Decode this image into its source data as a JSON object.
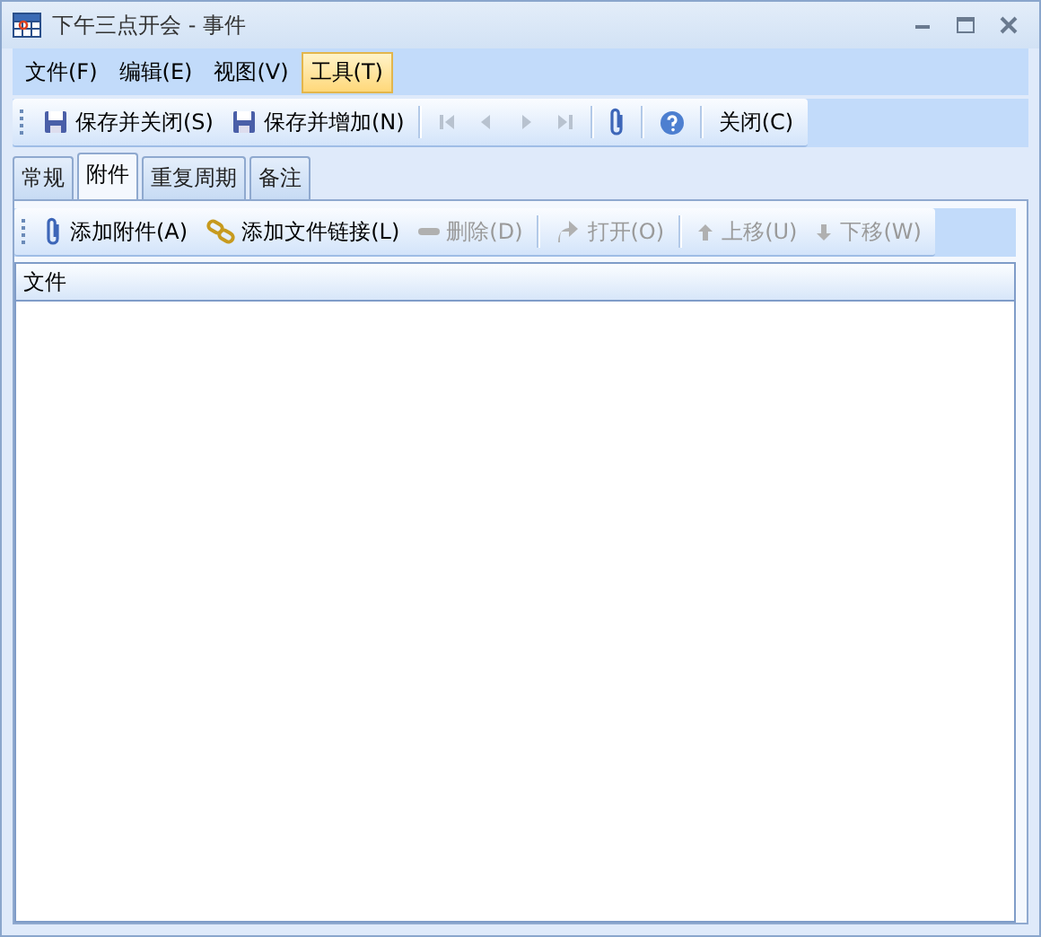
{
  "window": {
    "title": "下午三点开会 - 事件"
  },
  "menu": [
    {
      "label": "文件(F)",
      "selected": false
    },
    {
      "label": "编辑(E)",
      "selected": false
    },
    {
      "label": "视图(V)",
      "selected": false
    },
    {
      "label": "工具(T)",
      "selected": true
    }
  ],
  "toolbar": [
    {
      "kind": "button",
      "label": "保存并关闭(S)",
      "disabled": false
    },
    {
      "kind": "button",
      "label": "保存并增加(N)",
      "disabled": false
    },
    {
      "kind": "separator"
    },
    {
      "kind": "icon",
      "disabled": true
    },
    {
      "kind": "icon",
      "disabled": true
    },
    {
      "kind": "icon",
      "disabled": true
    },
    {
      "kind": "icon",
      "disabled": true
    },
    {
      "kind": "separator"
    },
    {
      "kind": "icon",
      "disabled": false
    },
    {
      "kind": "separator"
    },
    {
      "kind": "icon",
      "disabled": false
    },
    {
      "kind": "separator"
    },
    {
      "kind": "button",
      "label": "关闭(C)",
      "disabled": false
    }
  ],
  "tabs": [
    {
      "label": "常规",
      "selected": false
    },
    {
      "label": "附件",
      "selected": true
    },
    {
      "label": "重复周期",
      "selected": false
    },
    {
      "label": "备注",
      "selected": false
    }
  ],
  "attachment_toolbar": [
    {
      "kind": "button",
      "label": "添加附件(A)",
      "disabled": false
    },
    {
      "kind": "button",
      "label": "添加文件链接(L)",
      "disabled": false
    },
    {
      "kind": "button",
      "label": "删除(D)",
      "disabled": true
    },
    {
      "kind": "separator"
    },
    {
      "kind": "button",
      "label": "打开(O)",
      "disabled": true
    },
    {
      "kind": "separator"
    },
    {
      "kind": "button",
      "label": "上移(U)",
      "disabled": true
    },
    {
      "kind": "button",
      "label": "下移(W)",
      "disabled": true
    }
  ],
  "file_list": {
    "columns": [
      "文件"
    ]
  }
}
